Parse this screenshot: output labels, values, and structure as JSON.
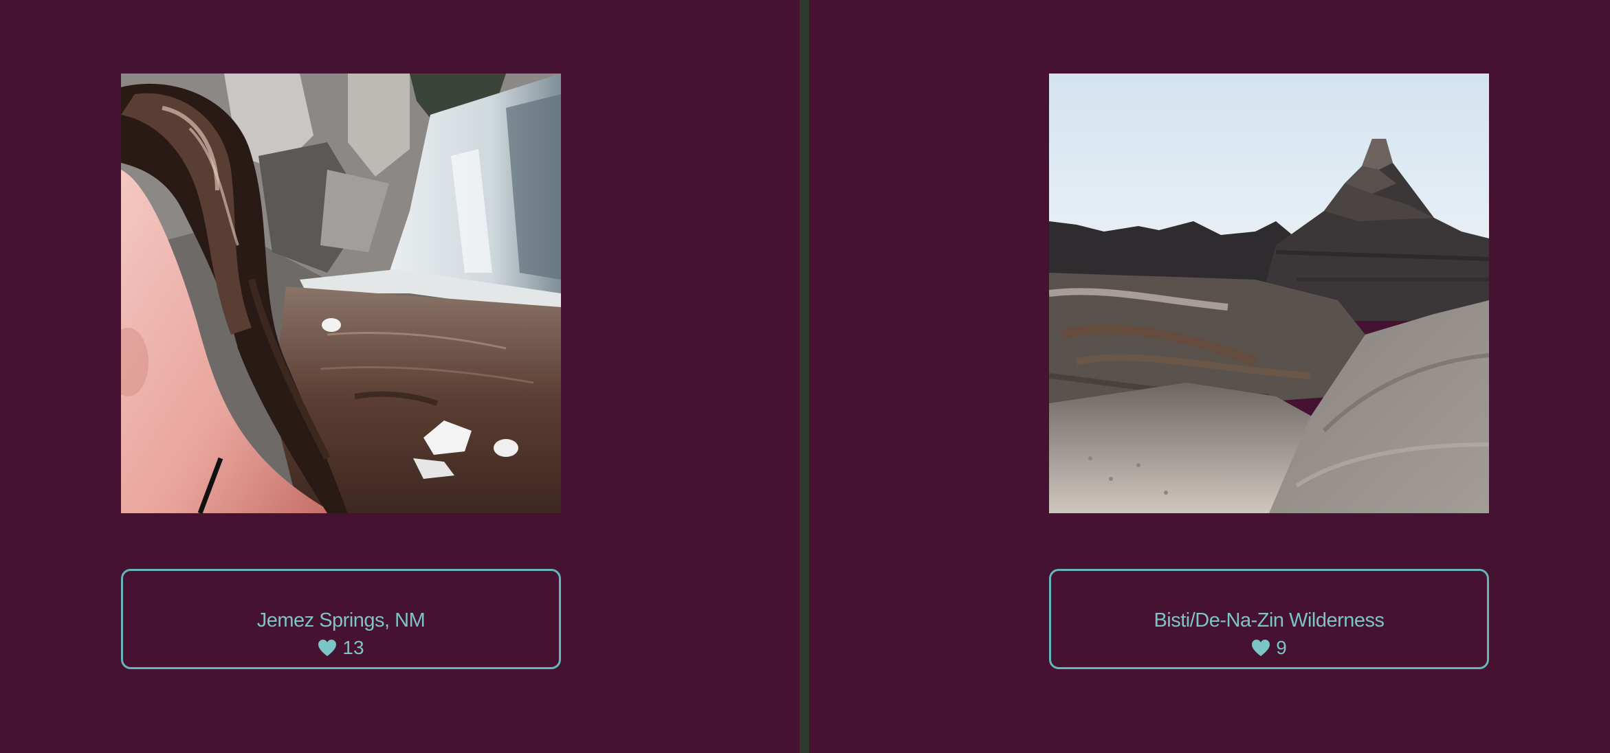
{
  "colors": {
    "background": "#451232",
    "divider": "#2e3a30",
    "accent": "#63b7b8",
    "caption_text": "#7cc5c7"
  },
  "posts": [
    {
      "location": "Jemez Springs, NM",
      "likes": "13",
      "photo_subject": "waterfall-selfie",
      "like_icon": "heart-icon"
    },
    {
      "location": "Bisti/De-Na-Zin Wilderness",
      "likes": "9",
      "photo_subject": "badlands-hoodoo",
      "like_icon": "heart-icon"
    }
  ]
}
